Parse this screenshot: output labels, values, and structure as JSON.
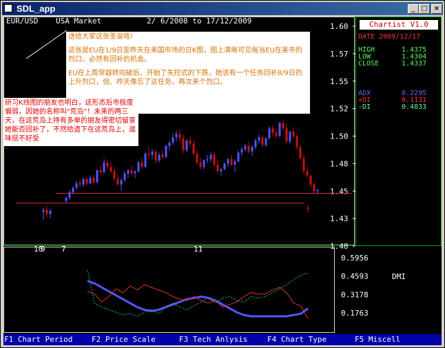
{
  "window": {
    "title": "SDL_app",
    "minimize_glyph": "_",
    "maximize_glyph": "□",
    "close_glyph": "×"
  },
  "header": {
    "symbol": "EUR/USD",
    "market": "USA Market",
    "date_range": "2/ 6/2008 to 17/12/2009"
  },
  "info_panel": {
    "app_label": "Chartist V1.0",
    "date": "DATE 2009/12/17",
    "high_label": "HIGH",
    "high": "1.4375",
    "low_label": "LOW",
    "low": "1.4304",
    "close_label": "CLOSE",
    "close": "1.4337",
    "adx_label": "ADX",
    "adx": "0.2295",
    "pdi_label": "+DI",
    "pdi": "0.1131",
    "mdi_label": "-DI",
    "mdi": "0.4833"
  },
  "annotation_main": {
    "line1": "送给大家这张圣诞咭!",
    "line2": "这张是EU在1/9日至昨天在美国市场的日K图，图上清晰可见每当EU在美市的烈口，必然有回补的机会。",
    "line3": "EU在上周穿越转向破后，开始了失控式的下跌，她该有一个任务回补8/9日的上升烈口，但、昨天像忘了这任务，再次来个烈口。"
  },
  "annotation_side": {
    "text": "研习K线图的朋友也明白，这形态后市极度偏弱，因她的名称叫\"荒岛\"！未来的两三天，在这荒岛上持有多单的朋友得密切留意她能否回补了，不然给遗下在这荒岛上，滋味挺不好受"
  },
  "price_axis": [
    "1.60",
    "1.57",
    "1.55",
    "1.52",
    "1.50",
    "1.48",
    "1.45",
    "1.43",
    "1.40"
  ],
  "date_labels": [
    "10",
    "9",
    "7",
    "11"
  ],
  "indicator": {
    "name": "DMI",
    "axis": [
      "0.5956",
      "0.4593",
      "0.3178",
      "0.1763"
    ]
  },
  "colors": {
    "bull_candle": "#5555ff",
    "bear_candle": "#cc1111",
    "gap_line": "#dd3333",
    "panel_border": "#00aa00",
    "adx": "#5555ff",
    "pdi": "#dd3322",
    "mdi": "#00cc88"
  },
  "function_keys": [
    {
      "label": "F1 Chart Period"
    },
    {
      "label": "F2 Price Scale"
    },
    {
      "label": "F3 Tech Anlysis"
    },
    {
      "label": "F4 Chart Type"
    },
    {
      "label": "F5 Miscell"
    }
  ],
  "chart_data": [
    {
      "type": "candlestick",
      "title": "EUR/USD",
      "ylim": [
        1.4,
        1.6
      ],
      "note": "approx. daily OHLC read from chart, 2009-09-01 to 2009-12-17",
      "candles": [
        {
          "o": 1.431,
          "h": 1.435,
          "l": 1.424,
          "c": 1.433
        },
        {
          "o": 1.433,
          "h": 1.437,
          "l": 1.426,
          "c": 1.429
        },
        {
          "o": 1.429,
          "h": 1.434,
          "l": 1.425,
          "c": 1.432
        },
        {
          "o": 1.441,
          "h": 1.445,
          "l": 1.439,
          "c": 1.444
        },
        {
          "o": 1.444,
          "h": 1.451,
          "l": 1.442,
          "c": 1.449
        },
        {
          "o": 1.449,
          "h": 1.454,
          "l": 1.447,
          "c": 1.453
        },
        {
          "o": 1.453,
          "h": 1.459,
          "l": 1.451,
          "c": 1.457
        },
        {
          "o": 1.457,
          "h": 1.46,
          "l": 1.453,
          "c": 1.456
        },
        {
          "o": 1.456,
          "h": 1.462,
          "l": 1.454,
          "c": 1.461
        },
        {
          "o": 1.461,
          "h": 1.463,
          "l": 1.455,
          "c": 1.457
        },
        {
          "o": 1.457,
          "h": 1.464,
          "l": 1.456,
          "c": 1.462
        },
        {
          "o": 1.462,
          "h": 1.465,
          "l": 1.456,
          "c": 1.458
        },
        {
          "o": 1.458,
          "h": 1.47,
          "l": 1.457,
          "c": 1.469
        },
        {
          "o": 1.469,
          "h": 1.473,
          "l": 1.465,
          "c": 1.467
        },
        {
          "o": 1.467,
          "h": 1.479,
          "l": 1.466,
          "c": 1.476
        },
        {
          "o": 1.476,
          "h": 1.478,
          "l": 1.47,
          "c": 1.472
        },
        {
          "o": 1.472,
          "h": 1.476,
          "l": 1.466,
          "c": 1.468
        },
        {
          "o": 1.468,
          "h": 1.472,
          "l": 1.459,
          "c": 1.461
        },
        {
          "o": 1.461,
          "h": 1.465,
          "l": 1.455,
          "c": 1.456
        },
        {
          "o": 1.456,
          "h": 1.462,
          "l": 1.45,
          "c": 1.46
        },
        {
          "o": 1.46,
          "h": 1.468,
          "l": 1.459,
          "c": 1.466
        },
        {
          "o": 1.466,
          "h": 1.47,
          "l": 1.462,
          "c": 1.469
        },
        {
          "o": 1.469,
          "h": 1.473,
          "l": 1.464,
          "c": 1.466
        },
        {
          "o": 1.466,
          "h": 1.469,
          "l": 1.462,
          "c": 1.468
        },
        {
          "o": 1.468,
          "h": 1.478,
          "l": 1.467,
          "c": 1.476
        },
        {
          "o": 1.476,
          "h": 1.48,
          "l": 1.47,
          "c": 1.472
        },
        {
          "o": 1.472,
          "h": 1.486,
          "l": 1.471,
          "c": 1.484
        },
        {
          "o": 1.484,
          "h": 1.49,
          "l": 1.48,
          "c": 1.483
        },
        {
          "o": 1.483,
          "h": 1.488,
          "l": 1.479,
          "c": 1.486
        },
        {
          "o": 1.486,
          "h": 1.487,
          "l": 1.475,
          "c": 1.478
        },
        {
          "o": 1.478,
          "h": 1.485,
          "l": 1.476,
          "c": 1.483
        },
        {
          "o": 1.483,
          "h": 1.486,
          "l": 1.479,
          "c": 1.481
        },
        {
          "o": 1.481,
          "h": 1.492,
          "l": 1.48,
          "c": 1.491
        },
        {
          "o": 1.491,
          "h": 1.496,
          "l": 1.487,
          "c": 1.494
        },
        {
          "o": 1.494,
          "h": 1.502,
          "l": 1.492,
          "c": 1.499
        },
        {
          "o": 1.499,
          "h": 1.505,
          "l": 1.495,
          "c": 1.502
        },
        {
          "o": 1.502,
          "h": 1.506,
          "l": 1.495,
          "c": 1.498
        },
        {
          "o": 1.498,
          "h": 1.501,
          "l": 1.484,
          "c": 1.487
        },
        {
          "o": 1.487,
          "h": 1.497,
          "l": 1.485,
          "c": 1.496
        },
        {
          "o": 1.496,
          "h": 1.5,
          "l": 1.49,
          "c": 1.493
        },
        {
          "o": 1.493,
          "h": 1.496,
          "l": 1.482,
          "c": 1.484
        },
        {
          "o": 1.484,
          "h": 1.487,
          "l": 1.474,
          "c": 1.476
        },
        {
          "o": 1.476,
          "h": 1.48,
          "l": 1.47,
          "c": 1.472
        },
        {
          "o": 1.472,
          "h": 1.479,
          "l": 1.47,
          "c": 1.478
        },
        {
          "o": 1.478,
          "h": 1.483,
          "l": 1.475,
          "c": 1.479
        },
        {
          "o": 1.479,
          "h": 1.485,
          "l": 1.476,
          "c": 1.483
        },
        {
          "o": 1.483,
          "h": 1.485,
          "l": 1.472,
          "c": 1.474
        },
        {
          "o": 1.474,
          "h": 1.478,
          "l": 1.466,
          "c": 1.468
        },
        {
          "o": 1.468,
          "h": 1.471,
          "l": 1.464,
          "c": 1.47
        },
        {
          "o": 1.47,
          "h": 1.476,
          "l": 1.469,
          "c": 1.475
        },
        {
          "o": 1.475,
          "h": 1.48,
          "l": 1.472,
          "c": 1.479
        },
        {
          "o": 1.479,
          "h": 1.483,
          "l": 1.472,
          "c": 1.474
        },
        {
          "o": 1.474,
          "h": 1.479,
          "l": 1.467,
          "c": 1.477
        },
        {
          "o": 1.477,
          "h": 1.487,
          "l": 1.476,
          "c": 1.485
        },
        {
          "o": 1.485,
          "h": 1.49,
          "l": 1.482,
          "c": 1.488
        },
        {
          "o": 1.488,
          "h": 1.493,
          "l": 1.486,
          "c": 1.491
        },
        {
          "o": 1.491,
          "h": 1.495,
          "l": 1.484,
          "c": 1.486
        },
        {
          "o": 1.486,
          "h": 1.492,
          "l": 1.482,
          "c": 1.49
        },
        {
          "o": 1.49,
          "h": 1.498,
          "l": 1.488,
          "c": 1.496
        },
        {
          "o": 1.496,
          "h": 1.502,
          "l": 1.493,
          "c": 1.499
        },
        {
          "o": 1.499,
          "h": 1.501,
          "l": 1.49,
          "c": 1.492
        },
        {
          "o": 1.492,
          "h": 1.499,
          "l": 1.49,
          "c": 1.498
        },
        {
          "o": 1.498,
          "h": 1.509,
          "l": 1.497,
          "c": 1.507
        },
        {
          "o": 1.507,
          "h": 1.51,
          "l": 1.5,
          "c": 1.503
        },
        {
          "o": 1.503,
          "h": 1.506,
          "l": 1.498,
          "c": 1.5
        },
        {
          "o": 1.5,
          "h": 1.513,
          "l": 1.499,
          "c": 1.512
        },
        {
          "o": 1.512,
          "h": 1.514,
          "l": 1.505,
          "c": 1.507
        },
        {
          "o": 1.507,
          "h": 1.511,
          "l": 1.493,
          "c": 1.495
        },
        {
          "o": 1.495,
          "h": 1.505,
          "l": 1.493,
          "c": 1.504
        },
        {
          "o": 1.504,
          "h": 1.508,
          "l": 1.498,
          "c": 1.5
        },
        {
          "o": 1.5,
          "h": 1.502,
          "l": 1.488,
          "c": 1.49
        },
        {
          "o": 1.49,
          "h": 1.492,
          "l": 1.478,
          "c": 1.48
        },
        {
          "o": 1.48,
          "h": 1.483,
          "l": 1.466,
          "c": 1.468
        },
        {
          "o": 1.468,
          "h": 1.472,
          "l": 1.462,
          "c": 1.464
        },
        {
          "o": 1.464,
          "h": 1.465,
          "l": 1.453,
          "c": 1.456
        },
        {
          "o": 1.456,
          "h": 1.458,
          "l": 1.448,
          "c": 1.45
        },
        {
          "o": 1.45,
          "h": 1.452,
          "l": 1.447,
          "c": 1.451
        },
        {
          "o": 1.435,
          "h": 1.4375,
          "l": 1.4304,
          "c": 1.4337
        }
      ],
      "gap_line_level": 1.439
    },
    {
      "type": "line",
      "title": "DMI",
      "ylim": [
        0.1,
        0.62
      ],
      "series": [
        {
          "name": "ADX",
          "values": [
            0.42,
            0.4,
            0.37,
            0.34,
            0.31,
            0.28,
            0.25,
            0.22,
            0.2,
            0.19,
            0.2,
            0.22,
            0.24,
            0.26,
            0.28,
            0.29,
            0.3,
            0.29,
            0.27,
            0.24,
            0.21,
            0.18,
            0.16,
            0.15,
            0.15,
            0.15,
            0.15,
            0.15,
            0.15,
            0.16,
            0.17,
            0.21
          ]
        },
        {
          "name": "+DI",
          "values": [
            0.34,
            0.32,
            0.26,
            0.3,
            0.36,
            0.33,
            0.38,
            0.35,
            0.39,
            0.37,
            0.35,
            0.33,
            0.3,
            0.28,
            0.27,
            0.3,
            0.27,
            0.25,
            0.27,
            0.22,
            0.24,
            0.26,
            0.3,
            0.33,
            0.32,
            0.32,
            0.35,
            0.37,
            0.33,
            0.25,
            0.23,
            0.13
          ]
        },
        {
          "name": "-DI",
          "values": [
            0.5,
            0.25,
            0.22,
            0.2,
            0.18,
            0.16,
            0.17,
            0.15,
            0.18,
            0.2,
            0.17,
            0.22,
            0.25,
            0.22,
            0.2,
            0.23,
            0.26,
            0.29,
            0.25,
            0.29,
            0.3,
            0.27,
            0.26,
            0.3,
            0.29,
            0.3,
            0.33,
            0.36,
            0.39,
            0.43,
            0.46,
            0.48
          ]
        }
      ]
    }
  ]
}
